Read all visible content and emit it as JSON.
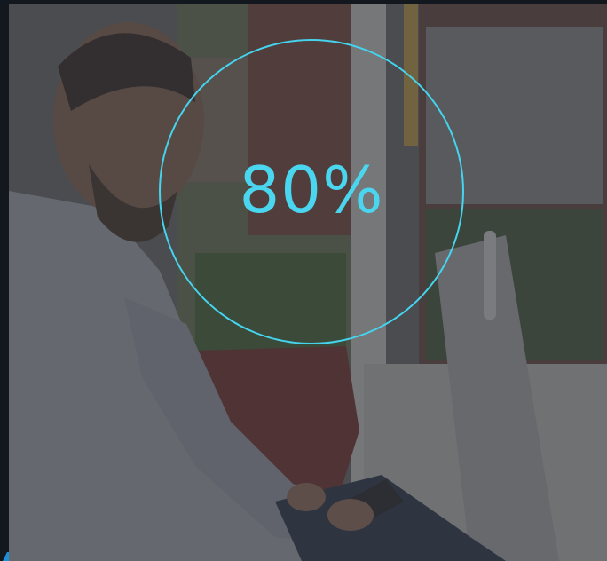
{
  "stat": {
    "value": "80%",
    "accent_color": "#45d4ee"
  },
  "background_image": {
    "icon": "photo-man-reading-phone-on-train"
  }
}
